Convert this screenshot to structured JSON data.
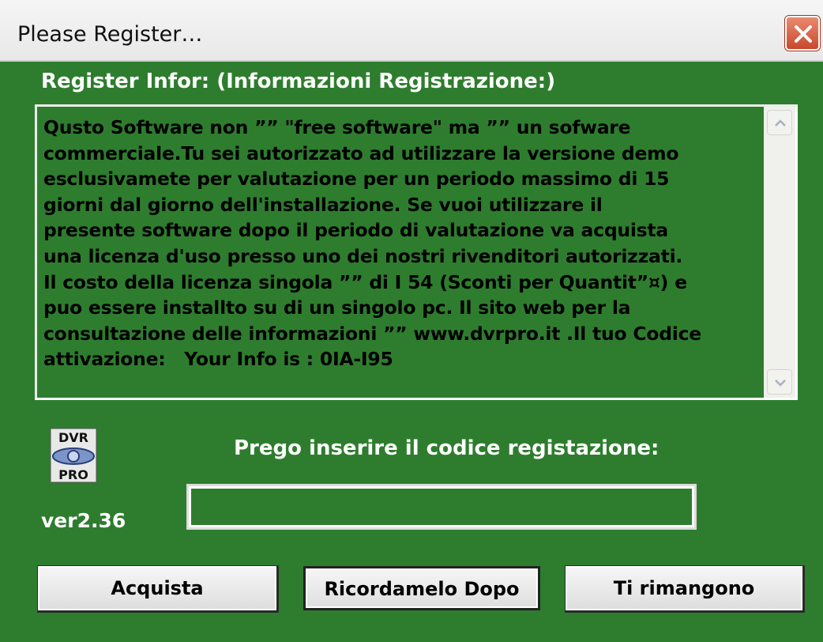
{
  "window": {
    "title": "Please Register…"
  },
  "register_info": {
    "label": "Register Infor: (Informazioni Registrazione:)",
    "text": "Qusto Software non ”” \"free software\" ma ”” un sofware\ncommerciale.Tu sei autorizzato ad utilizzare la versione demo\nesclusivamete per valutazione per un periodo massimo di 15\ngiorni dal giorno dell'installazione. Se vuoi utilizzare il\npresente software dopo il periodo di valutazione va acquista\nuna licenza d'uso presso uno dei nostri rivenditori autorizzati.\nIl costo della licenza singola ”” di I 54 (Sconti per Quantit”¤) e\npuo essere installto su di un singolo pc. Il sito web per la\nconsultazione delle informazioni ”” www.dvrpro.it .Il tuo Codice\nattivazione:   Your Info is : 0IA-I95"
  },
  "logo": {
    "top_text": "DVR",
    "bottom_text": "PRO",
    "icon": "dvr-pro-logo-icon"
  },
  "version": "ver2.36",
  "registration": {
    "prompt": "Prego inserire il codice registazione:",
    "value": "",
    "placeholder": ""
  },
  "buttons": {
    "buy": "Acquista",
    "remind_later": "Ricordamelo Dopo",
    "remaining": "Ti rimangono"
  },
  "colors": {
    "background": "#2e7d2e",
    "close_button": "#c9482c"
  }
}
